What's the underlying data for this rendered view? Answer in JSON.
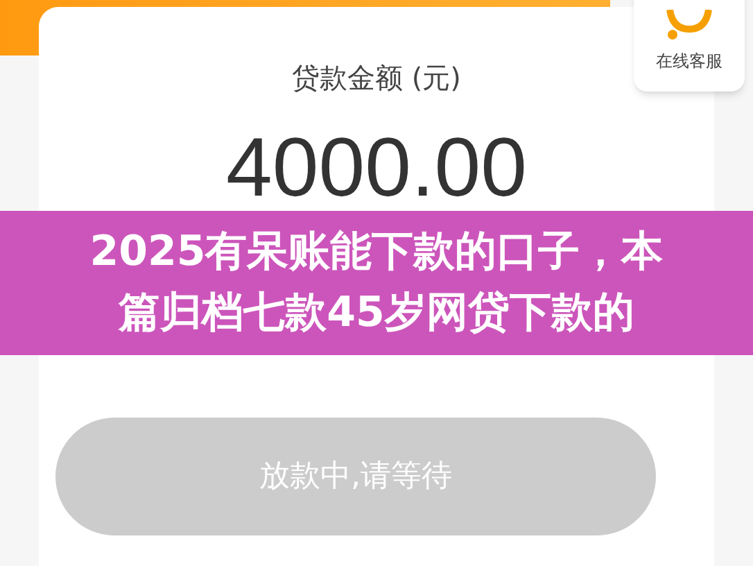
{
  "service": {
    "label": "在线客服"
  },
  "loan": {
    "label": "贷款金额 (元)",
    "amount": "4000.00"
  },
  "action_button": {
    "label": "放款中,请等待",
    "disabled": true
  },
  "banner": {
    "lines": [
      "2025有呆账能下款的口子，本",
      "篇归档七款45岁网贷下款的"
    ]
  }
}
